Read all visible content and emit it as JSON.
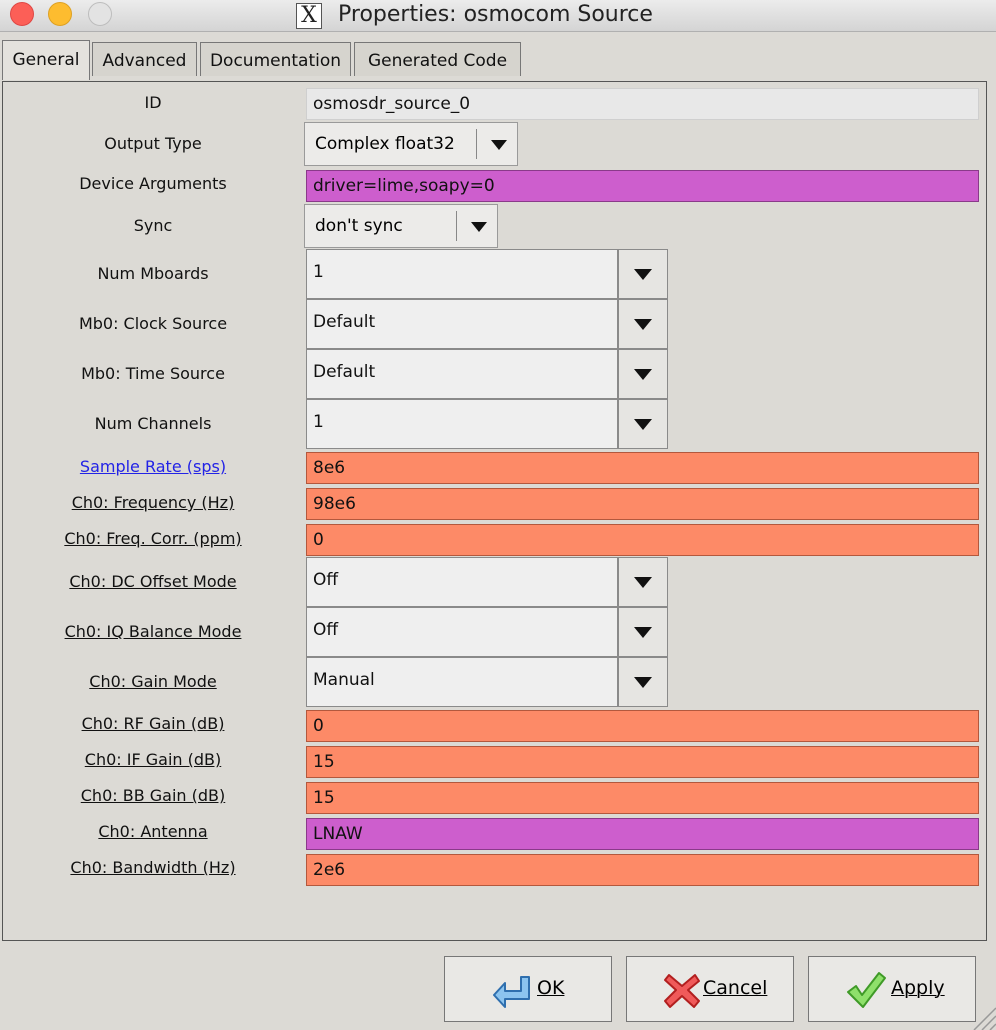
{
  "window": {
    "title": "Properties: osmocom Source",
    "x_logo": "X"
  },
  "tabs": [
    {
      "label": "General"
    },
    {
      "label": "Advanced"
    },
    {
      "label": "Documentation"
    },
    {
      "label": "Generated Code"
    }
  ],
  "params": {
    "id": {
      "label": "ID",
      "value": "osmosdr_source_0"
    },
    "output_type": {
      "label": "Output Type",
      "value": "Complex float32"
    },
    "device_args": {
      "label": "Device Arguments",
      "value": "driver=lime,soapy=0"
    },
    "sync": {
      "label": "Sync",
      "value": "don't sync"
    },
    "num_mboards": {
      "label": "Num Mboards",
      "value": "1"
    },
    "mb0_clock": {
      "label": "Mb0: Clock Source",
      "value": "Default"
    },
    "mb0_time": {
      "label": "Mb0: Time Source",
      "value": "Default"
    },
    "num_channels": {
      "label": "Num Channels",
      "value": "1"
    },
    "sample_rate": {
      "label": "Sample Rate (sps)",
      "value": "8e6"
    },
    "ch0_freq": {
      "label": "Ch0: Frequency (Hz)",
      "value": "98e6"
    },
    "ch0_freq_corr": {
      "label": "Ch0: Freq. Corr. (ppm)",
      "value": "0"
    },
    "ch0_dc_offset": {
      "label": "Ch0: DC Offset Mode",
      "value": "Off"
    },
    "ch0_iq_balance": {
      "label": "Ch0: IQ Balance Mode",
      "value": "Off"
    },
    "ch0_gain_mode": {
      "label": "Ch0: Gain Mode",
      "value": "Manual"
    },
    "ch0_rf_gain": {
      "label": "Ch0: RF Gain (dB)",
      "value": "0"
    },
    "ch0_if_gain": {
      "label": "Ch0: IF Gain (dB)",
      "value": "15"
    },
    "ch0_bb_gain": {
      "label": "Ch0: BB Gain (dB)",
      "value": "15"
    },
    "ch0_antenna": {
      "label": "Ch0: Antenna",
      "value": "LNAW"
    },
    "ch0_bandwidth": {
      "label": "Ch0: Bandwidth (Hz)",
      "value": "2e6"
    }
  },
  "buttons": {
    "ok": "OK",
    "cancel": "Cancel",
    "apply": "Apply"
  },
  "colors": {
    "float_field": "#fd8a67",
    "string_field": "#cd5ecd",
    "readonly_field": "#e8e8e8",
    "link": "#2323e6"
  },
  "icons": [
    "close-light",
    "minimize-light",
    "maximize-light",
    "x11-icon",
    "ok-arrow-icon",
    "cancel-x-icon",
    "apply-check-icon"
  ]
}
